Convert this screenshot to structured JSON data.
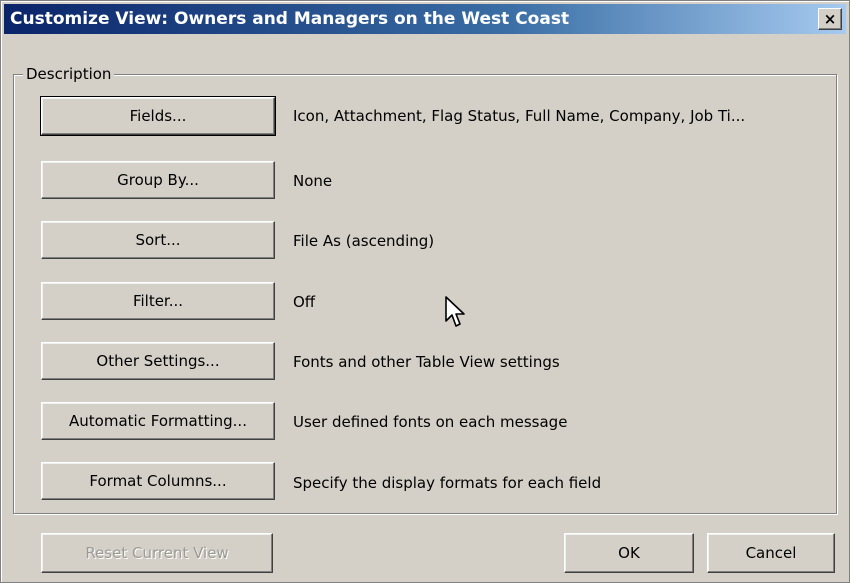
{
  "window": {
    "title": "Customize View: Owners and Managers on the West Coast",
    "close_label": "×"
  },
  "group": {
    "label": "Description"
  },
  "rows": [
    {
      "button": "Fields...",
      "description": "Icon, Attachment, Flag Status, Full Name, Company, Job Ti..."
    },
    {
      "button": "Group By...",
      "description": "None"
    },
    {
      "button": "Sort...",
      "description": "File As (ascending)"
    },
    {
      "button": "Filter...",
      "description": "Off"
    },
    {
      "button": "Other Settings...",
      "description": "Fonts and other Table View settings"
    },
    {
      "button": "Automatic Formatting...",
      "description": "User defined fonts on each message"
    },
    {
      "button": "Format Columns...",
      "description": "Specify the display formats for each field"
    }
  ],
  "footer": {
    "reset_label": "Reset Current View",
    "ok_label": "OK",
    "cancel_label": "Cancel"
  },
  "icons": {
    "close": "close-icon",
    "cursor": "mouse-pointer-icon"
  },
  "colors": {
    "title_start": "#0a246a",
    "title_end": "#a6caf0",
    "face": "#d4d0c8"
  }
}
